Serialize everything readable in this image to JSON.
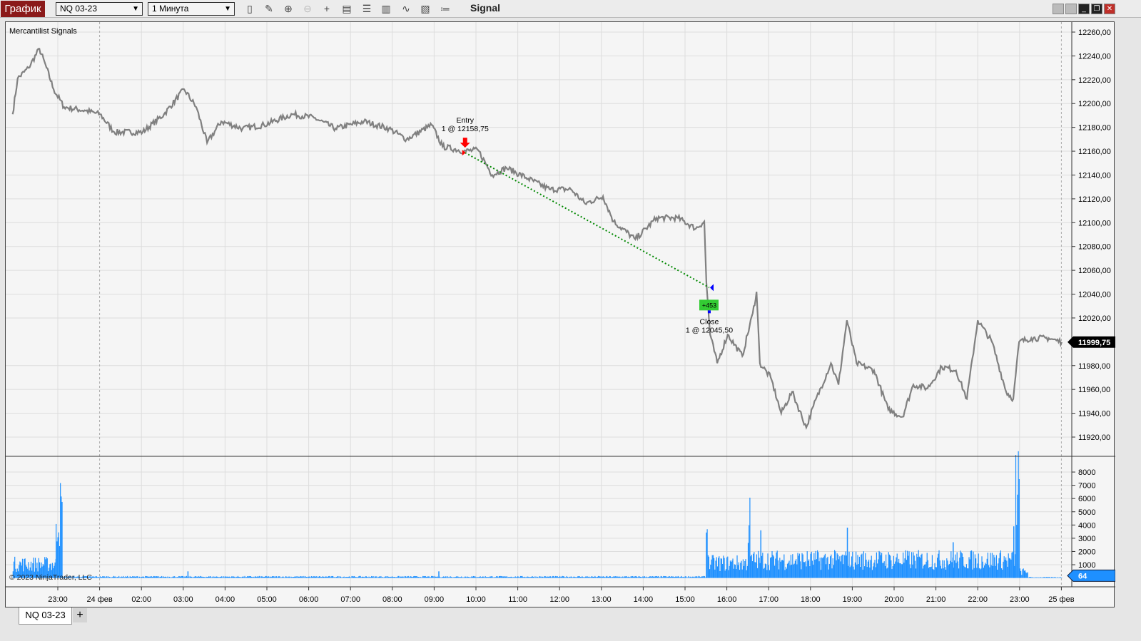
{
  "toolbar": {
    "app_button": "График",
    "instrument": "NQ 03-23",
    "interval": "1 Минута",
    "title": "Signal",
    "tools": [
      "bar-style-icon",
      "pencil-icon",
      "zoom-in-icon",
      "zoom-out-icon",
      "crosshair-icon",
      "data-box-icon",
      "properties-icon",
      "indicators-icon",
      "strategies-icon",
      "template-icon",
      "list-icon"
    ]
  },
  "chart": {
    "indicator_label": "Mercantilist Signals",
    "copyright": "© 2023 NinjaTrader, LLC",
    "current_price": "11999,75",
    "current_volume": "64",
    "entry": {
      "label": "Entry",
      "detail": "1 @ 12158,75",
      "price": 12158.75,
      "t": 9.74
    },
    "exit": {
      "label": "Close",
      "detail": "1 @ 12045,50",
      "price": 12045.5,
      "t": 15.58
    },
    "pnl": "+453",
    "colors": {
      "price": "#808080",
      "volume": "#1e90ff",
      "entry": "#ff0000",
      "exit": "#0000ff",
      "pnl_bg": "#33cc33",
      "trade_line": "#008800"
    }
  },
  "chart_data": {
    "type": "line",
    "price_axis": {
      "ticks": [
        "12260,00",
        "12240,00",
        "12220,00",
        "12200,00",
        "12180,00",
        "12160,00",
        "12140,00",
        "12120,00",
        "12100,00",
        "12080,00",
        "12060,00",
        "12040,00",
        "12020,00",
        "11980,00",
        "11960,00",
        "11940,00",
        "11920,00"
      ],
      "range": [
        11911,
        12269
      ]
    },
    "volume_axis": {
      "ticks": [
        "8000",
        "7000",
        "6000",
        "5000",
        "4000",
        "3000",
        "2000",
        "1000"
      ]
    },
    "time_axis": {
      "ticks": [
        "23:00",
        "24 фев",
        "02:00",
        "03:00",
        "04:00",
        "05:00",
        "06:00",
        "07:00",
        "08:00",
        "09:00",
        "10:00",
        "11:00",
        "12:00",
        "13:00",
        "14:00",
        "15:00",
        "16:00",
        "17:00",
        "18:00",
        "19:00",
        "20:00",
        "21:00",
        "22:00",
        "23:00",
        "25 фев"
      ]
    },
    "price": [
      [
        -1.08,
        12191
      ],
      [
        -0.96,
        12221
      ],
      [
        -0.7,
        12230
      ],
      [
        -0.44,
        12246
      ],
      [
        -0.27,
        12230
      ],
      [
        -0.1,
        12212
      ],
      [
        0.15,
        12197
      ],
      [
        0.67,
        12194
      ],
      [
        1.01,
        12191
      ],
      [
        1.35,
        12176
      ],
      [
        2.03,
        12176
      ],
      [
        2.54,
        12191
      ],
      [
        3.02,
        12212
      ],
      [
        3.31,
        12197
      ],
      [
        3.57,
        12167
      ],
      [
        3.91,
        12185
      ],
      [
        4.42,
        12179
      ],
      [
        4.93,
        12182
      ],
      [
        5.61,
        12191
      ],
      [
        6.13,
        12188
      ],
      [
        6.64,
        12179
      ],
      [
        7.32,
        12185
      ],
      [
        7.92,
        12179
      ],
      [
        8.34,
        12170
      ],
      [
        8.94,
        12182
      ],
      [
        9.2,
        12164
      ],
      [
        9.71,
        12160
      ],
      [
        10.05,
        12161
      ],
      [
        10.39,
        12140
      ],
      [
        10.73,
        12146
      ],
      [
        11.25,
        12137
      ],
      [
        11.76,
        12128
      ],
      [
        12.27,
        12128
      ],
      [
        12.61,
        12116
      ],
      [
        13.04,
        12122
      ],
      [
        13.29,
        12101
      ],
      [
        13.81,
        12086
      ],
      [
        14.32,
        12104
      ],
      [
        14.83,
        12104
      ],
      [
        15.26,
        12095
      ],
      [
        15.46,
        12101
      ],
      [
        15.51,
        12050
      ],
      [
        15.6,
        12006
      ],
      [
        15.77,
        11982
      ],
      [
        16.02,
        12006
      ],
      [
        16.37,
        11988
      ],
      [
        16.62,
        12024
      ],
      [
        16.71,
        12042
      ],
      [
        16.79,
        11982
      ],
      [
        17.05,
        11970
      ],
      [
        17.3,
        11940
      ],
      [
        17.56,
        11958
      ],
      [
        17.9,
        11928
      ],
      [
        18.07,
        11946
      ],
      [
        18.49,
        11982
      ],
      [
        18.67,
        11964
      ],
      [
        18.87,
        12018
      ],
      [
        19.1,
        11982
      ],
      [
        19.52,
        11976
      ],
      [
        19.86,
        11943
      ],
      [
        20.2,
        11937
      ],
      [
        20.46,
        11964
      ],
      [
        20.8,
        11961
      ],
      [
        21.14,
        11979
      ],
      [
        21.48,
        11976
      ],
      [
        21.74,
        11952
      ],
      [
        22.0,
        12018
      ],
      [
        22.34,
        12000
      ],
      [
        22.68,
        11958
      ],
      [
        22.85,
        11952
      ],
      [
        22.99,
        12000
      ],
      [
        23.28,
        12003
      ],
      [
        23.7,
        12003
      ],
      [
        24.01,
        11999.75
      ]
    ],
    "volume_segments": [
      [
        -1.08,
        -0.05,
        1300
      ],
      [
        -0.05,
        0.1,
        6100
      ],
      [
        0.1,
        15.5,
        120
      ],
      [
        15.5,
        15.56,
        4800
      ],
      [
        15.56,
        16.5,
        1400
      ],
      [
        16.5,
        16.56,
        5200
      ],
      [
        16.56,
        22.9,
        1700
      ],
      [
        22.9,
        23.0,
        8600
      ],
      [
        23.0,
        23.2,
        600
      ],
      [
        23.2,
        24.01,
        64
      ]
    ],
    "volume_peaks": [
      [
        18.87,
        3800
      ],
      [
        21.4,
        2700
      ],
      [
        22.85,
        3900
      ],
      [
        16.8,
        3600
      ],
      [
        3.1,
        500
      ],
      [
        9.1,
        500
      ]
    ]
  }
}
